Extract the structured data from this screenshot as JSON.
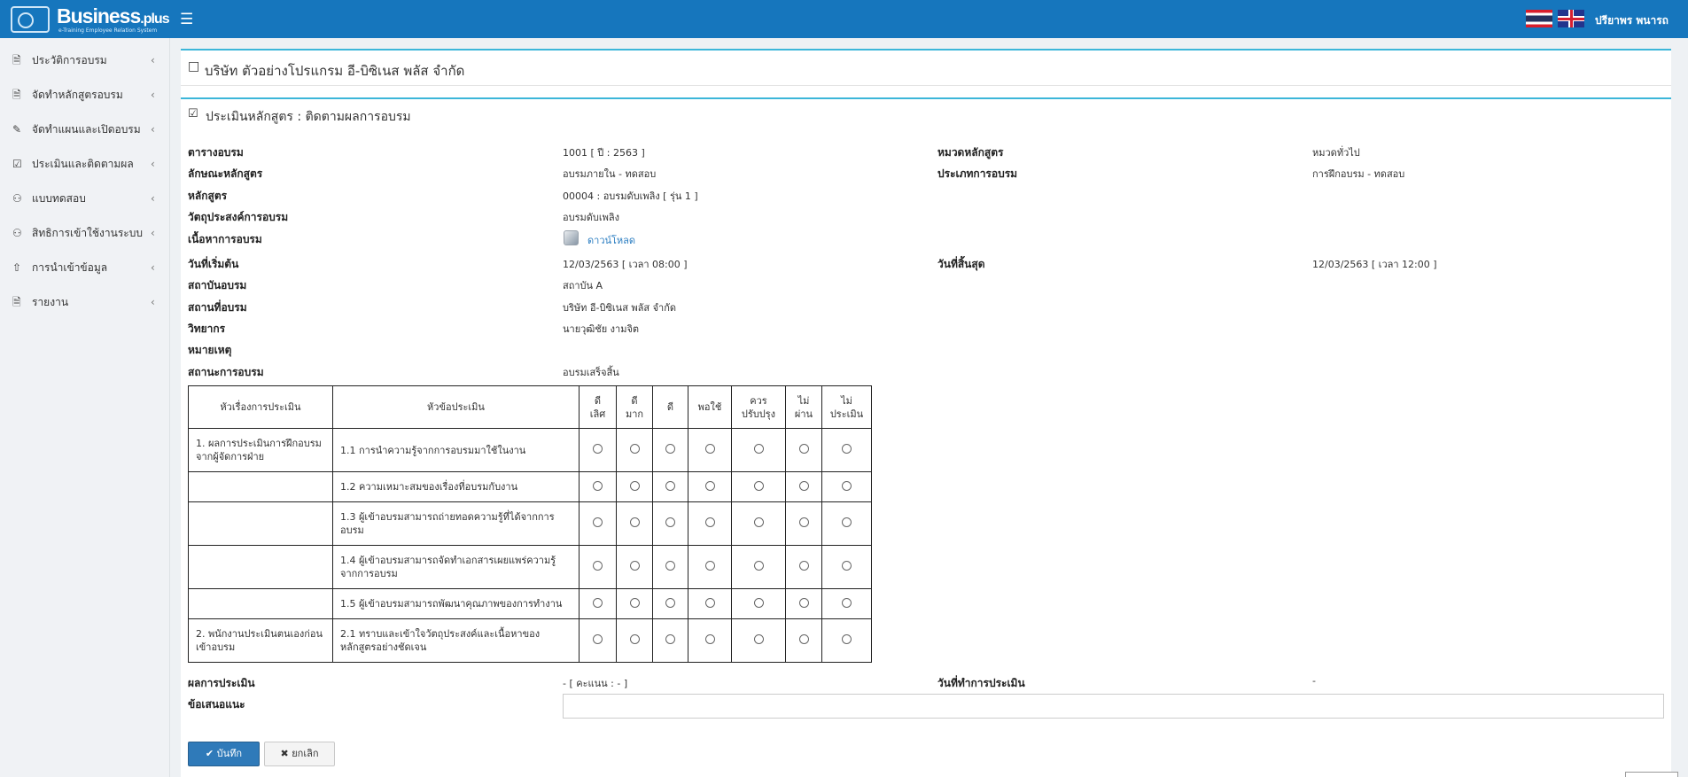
{
  "app": {
    "logo_text": "Business",
    "logo_suffix": ".plus",
    "logo_subtitle": "e-Training Employee Relation System",
    "menu_icon": "bars-icon",
    "user_name": "ปรียาพร พนารถ",
    "flags": [
      "thai-flag-icon",
      "uk-flag-icon"
    ]
  },
  "sidebar": {
    "items": [
      {
        "label": "ประวัติการอบรม",
        "icon": "file-icon"
      },
      {
        "label": "จัดทำหลักสูตรอบรม",
        "icon": "file-icon"
      },
      {
        "label": "จัดทำแผนและเปิดอบรม",
        "icon": "edit-icon"
      },
      {
        "label": "ประเมินและติดตามผล",
        "icon": "check-square-icon"
      },
      {
        "label": "แบบทดสอบ",
        "icon": "users-icon"
      },
      {
        "label": "สิทธิการเข้าใช้งานระบบ",
        "icon": "users-icon"
      },
      {
        "label": "การนำเข้าข้อมูล",
        "icon": "upload-icon"
      },
      {
        "label": "รายงาน",
        "icon": "file-pdf-icon"
      }
    ]
  },
  "page": {
    "company_title": "บริษัท ตัวอย่างโปรแกรม อี-บิซิเนส พลัส จำกัด",
    "section_title": "ประเมินหลักสูตร : ติดตามผลการอบรม"
  },
  "fields": {
    "schedule_label": "ตารางอบรม",
    "schedule_value": "1001 [ ปี : 2563 ]",
    "category_label": "หมวดหลักสูตร",
    "category_value": "หมวดทั่วไป",
    "nature_label": "ลักษณะหลักสูตร",
    "nature_value": "อบรมภายใน - ทดสอบ",
    "type_label": "ประเภทการอบรม",
    "type_value": "การฝึกอบรม - ทดสอบ",
    "course_label": "หลักสูตร",
    "course_value": "00004 : อบรมดับเพลิง [ รุ่น 1 ]",
    "objective_label": "วัตถุประสงค์การอบรม",
    "objective_value": "อบรมดับเพลิง",
    "content_label": "เนื้อหาการอบรม",
    "content_link": "ดาวน์โหลด",
    "start_label": "วันที่เริ่มต้น",
    "start_value": "12/03/2563 [ เวลา 08:00 ]",
    "end_label": "วันที่สิ้นสุด",
    "end_value": "12/03/2563 [ เวลา 12:00 ]",
    "institute_label": "สถาบันอบรม",
    "institute_value": "สถาบัน A",
    "location_label": "สถานที่อบรม",
    "location_value": "บริษัท อี-บิซิเนส พลัส จำกัด",
    "lecturer_label": "วิทยากร",
    "lecturer_value": "นายวุฒิชัย งามจิต",
    "remark_label": "หมายเหตุ",
    "remark_value": "",
    "status_label": "สถานะการอบรม",
    "status_value": "อบรมเสร็จสิ้น"
  },
  "table": {
    "col_topic": "หัวเรื่องการประเมิน",
    "col_item": "หัวข้อประเมิน",
    "rating_cols": [
      "ดี\nเลิศ",
      "ดี\nมาก",
      "ดี",
      "พอใช้",
      "ควร\nปรับปรุง",
      "ไม่\nผ่าน",
      "ไม่\nประเมิน"
    ],
    "rows": [
      {
        "topic": "1. ผลการประเมินการฝึกอบรมจากผู้จัดการฝ่าย",
        "item": "1.1 การนำความรู้จากการอบรมมาใช้ในงาน"
      },
      {
        "topic": "",
        "item": "1.2 ความเหมาะสมของเรื่องที่อบรมกับงาน"
      },
      {
        "topic": "",
        "item": "1.3 ผู้เข้าอบรมสามารถถ่ายทอดความรู้ที่ได้จากการอบรม"
      },
      {
        "topic": "",
        "item": "1.4 ผู้เข้าอบรมสามารถจัดทำเอกสารเผยแพร่ความรู้จากการอบรม"
      },
      {
        "topic": "",
        "item": "1.5 ผู้เข้าอบรมสามารถพัฒนาคุณภาพของการทำงาน"
      },
      {
        "topic": "2. พนักงานประเมินตนเองก่อนเข้าอบรม",
        "item": "2.1 ทราบและเข้าใจวัตถุประสงค์และเนื้อหาของหลักสูตรอย่างชัดเจน"
      }
    ]
  },
  "result": {
    "result_label": "ผลการประเมิน",
    "result_value": "- [ คะแนน : - ]",
    "eval_date_label": "วันที่ทำการประเมิน",
    "eval_date_value": "-",
    "suggestion_label": "ข้อเสนอแนะ",
    "suggestion_value": ""
  },
  "buttons": {
    "save": "บันทึก",
    "cancel": "ยกเลิก"
  }
}
